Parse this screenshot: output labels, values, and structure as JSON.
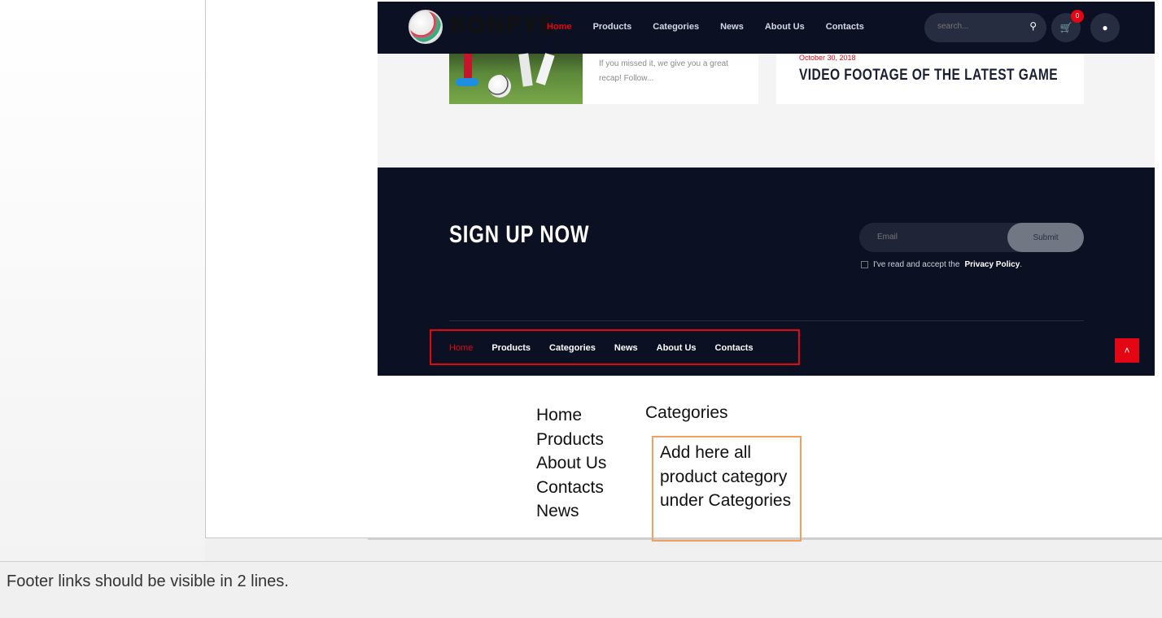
{
  "header": {
    "logo_text": "BONPYE",
    "nav": [
      "Home",
      "Products",
      "Categories",
      "News",
      "About Us",
      "Contacts"
    ],
    "active_nav": "Home",
    "search_placeholder": "search...",
    "cart_count": "0"
  },
  "news": {
    "card1_excerpt": "If you missed it, we give you a great recap! Follow...",
    "card2_date": "October 30, 2018",
    "card2_title": "VIDEO FOOTAGE OF THE LATEST GAME"
  },
  "footer": {
    "signup_title": "SIGN UP NOW",
    "email_placeholder": "Email",
    "submit_label": "Submit",
    "privacy_prefix": "I've read and accept the",
    "privacy_link": "Privacy Policy",
    "privacy_suffix": ".",
    "nav": [
      "Home",
      "Products",
      "Categories",
      "News",
      "About Us",
      "Contacts"
    ]
  },
  "annotation": {
    "left_column": [
      "Home",
      "Products",
      "About Us",
      "Contacts",
      "News"
    ],
    "right_heading": "Categories",
    "box_text": "Add here all product category under Categories"
  },
  "note": "Footer links should be visible in 2 lines.",
  "colors": {
    "accent": "#e30613",
    "dark": "#0b1023",
    "annotation_box": "#f0a060"
  }
}
